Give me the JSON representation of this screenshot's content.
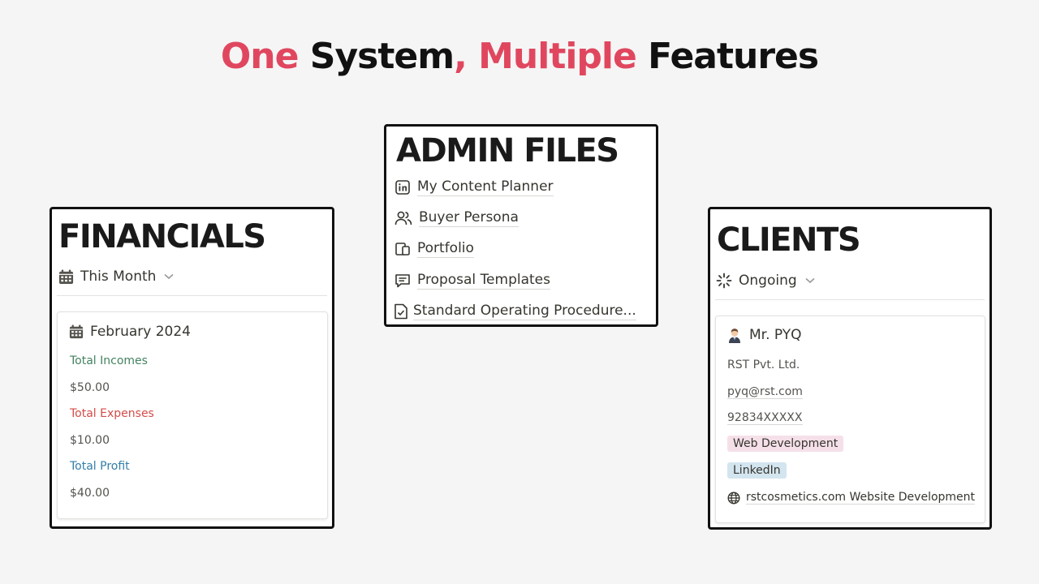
{
  "headline": {
    "part1": "One",
    "part2": " System",
    "part3": ", Multiple",
    "part4": " Features"
  },
  "colors": {
    "accent": "#e0475f",
    "income": "#448361",
    "expense": "#d44c47",
    "profit": "#337ea9",
    "tag_pink": "#f5e0e9",
    "tag_blue": "#d3e5ef"
  },
  "financials": {
    "title": "FINANCIALS",
    "view_label": "This Month",
    "view_icon": "calendar-icon",
    "entry": {
      "title": "February 2024",
      "total_incomes_label": "Total Incomes",
      "total_incomes_value": "$50.00",
      "total_expenses_label": "Total Expenses",
      "total_expenses_value": "$10.00",
      "total_profit_label": "Total Profit",
      "total_profit_value": "$40.00"
    }
  },
  "admin": {
    "title": "ADMIN FILES",
    "items": [
      {
        "label": "My Content Planner",
        "icon": "linkedin-icon"
      },
      {
        "label": "Buyer Persona",
        "icon": "users-icon"
      },
      {
        "label": "Portfolio",
        "icon": "portfolio-icon"
      },
      {
        "label": "Proposal Templates",
        "icon": "chat-bubble-icon"
      },
      {
        "label": "Standard Operating Procedure...",
        "icon": "document-check-icon"
      }
    ]
  },
  "clients": {
    "title": "CLIENTS",
    "view_label": "Ongoing",
    "view_icon": "loading-icon",
    "client": {
      "name": "Mr. PYQ",
      "company": "RST Pvt. Ltd.",
      "email": "pyq@rst.com",
      "phone": "92834XXXXX",
      "service_tag": "Web Development",
      "source_tag": "LinkedIn",
      "project": "rstcosmetics.com Website Development"
    }
  }
}
